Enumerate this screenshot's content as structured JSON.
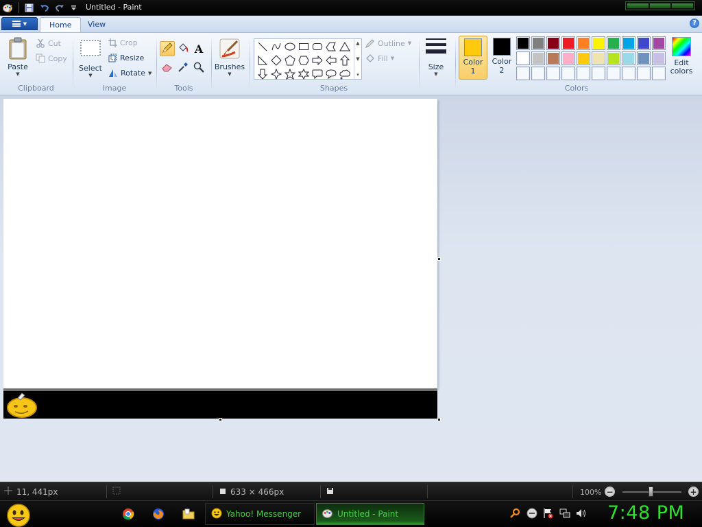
{
  "window": {
    "title": "Untitled - Paint"
  },
  "tabs": {
    "home": "Home",
    "view": "View"
  },
  "clipboard": {
    "paste": "Paste",
    "cut": "Cut",
    "copy": "Copy",
    "group": "Clipboard"
  },
  "image": {
    "select": "Select",
    "crop": "Crop",
    "resize": "Resize",
    "rotate": "Rotate",
    "group": "Image"
  },
  "tools": {
    "group": "Tools",
    "selected": "pencil"
  },
  "brushes": {
    "label": "Brushes"
  },
  "shapes": {
    "outline": "Outline",
    "fill": "Fill",
    "group": "Shapes",
    "items": [
      "line",
      "curve",
      "oval",
      "rectangle",
      "rounded-rectangle",
      "polygon",
      "triangle",
      "right-triangle",
      "diamond",
      "pentagon",
      "hexagon",
      "right-arrow",
      "left-arrow",
      "up-arrow",
      "down-arrow",
      "four-point-star",
      "five-point-star",
      "six-point-star",
      "rounded-callout",
      "oval-callout",
      "cloud-callout"
    ]
  },
  "size": {
    "label": "Size"
  },
  "colors": {
    "color1_label_a": "Color",
    "color1_label_b": "1",
    "color2_label_a": "Color",
    "color2_label_b": "2",
    "color1": "#ffc90e",
    "color2": "#000000",
    "edit_a": "Edit",
    "edit_b": "colors",
    "group": "Colors",
    "palette_row1": [
      "#000000",
      "#7f7f7f",
      "#880015",
      "#ed1c24",
      "#ff7f27",
      "#fff200",
      "#22b14c",
      "#00a2e8",
      "#3f48cc",
      "#a349a4"
    ],
    "palette_row2": [
      "#ffffff",
      "#c3c3c3",
      "#b97a57",
      "#ffaec9",
      "#ffc90e",
      "#efe4b0",
      "#b5e61d",
      "#99d9ea",
      "#7092be",
      "#c8bfe7"
    ],
    "palette_row3_count": 10
  },
  "status": {
    "cursor": "11, 441px",
    "dimensions": "633 × 466px",
    "zoom": "100%"
  },
  "taskbar": {
    "task1": "Yahoo! Messenger",
    "task2": "Untitled - Paint",
    "clock": "7:48 PM"
  }
}
